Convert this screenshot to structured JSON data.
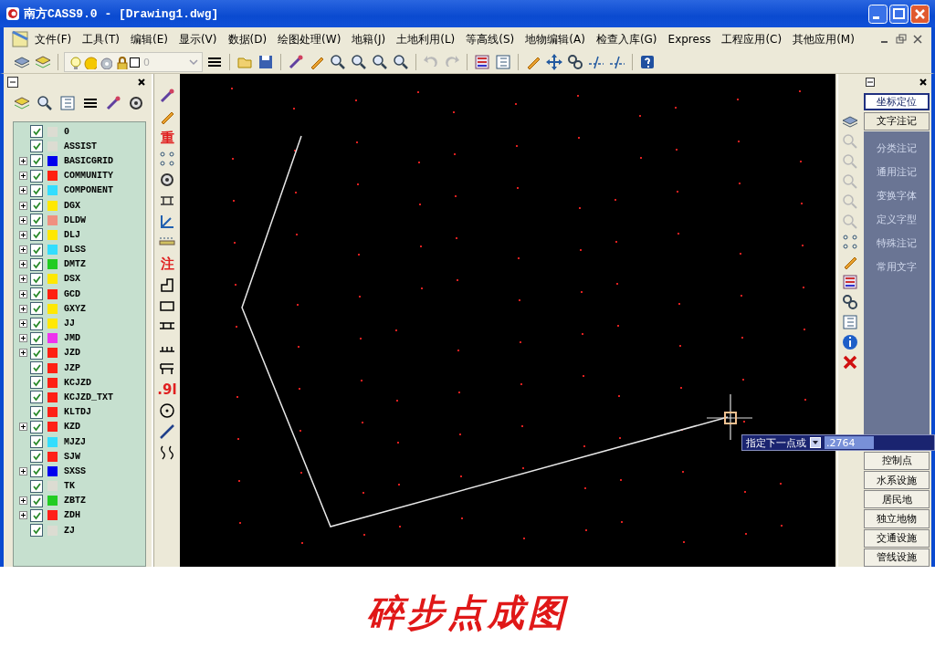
{
  "window": {
    "title": "南方CASS9.0 - [Drawing1.dwg]"
  },
  "menu": [
    "文件(F)",
    "工具(T)",
    "编辑(E)",
    "显示(V)",
    "数据(D)",
    "绘图处理(W)",
    "地籍(J)",
    "土地利用(L)",
    "等高线(S)",
    "地物编辑(A)",
    "检查入库(G)",
    "Express",
    "工程应用(C)",
    "其他应用(M)"
  ],
  "toolbar": {
    "layer_combo": {
      "value": "0"
    }
  },
  "layer_panel": {
    "layers": [
      {
        "name": "0",
        "kind": "leaf",
        "checked": true
      },
      {
        "name": "ASSIST",
        "kind": "leaf",
        "checked": true
      },
      {
        "name": "BASICGRID",
        "kind": "group",
        "checked": true,
        "color": "#0000ee"
      },
      {
        "name": "COMMUNITY",
        "kind": "group",
        "checked": true,
        "color": "#ff2010"
      },
      {
        "name": "COMPONENT",
        "kind": "group",
        "checked": true,
        "color": "#33ddff"
      },
      {
        "name": "DGX",
        "kind": "group",
        "checked": true,
        "color": "#ffe800"
      },
      {
        "name": "DLDW",
        "kind": "group",
        "checked": true,
        "color": "#f09080"
      },
      {
        "name": "DLJ",
        "kind": "group",
        "checked": true,
        "color": "#ffe801"
      },
      {
        "name": "DLSS",
        "kind": "group",
        "checked": true,
        "color": "#33ddfe"
      },
      {
        "name": "DMTZ",
        "kind": "group",
        "checked": true,
        "color": "#22cc22"
      },
      {
        "name": "DSX",
        "kind": "group",
        "checked": true,
        "color": "#ffe802"
      },
      {
        "name": "GCD",
        "kind": "group",
        "checked": true,
        "color": "#ff2011"
      },
      {
        "name": "GXYZ",
        "kind": "group",
        "checked": true,
        "color": "#ffe803"
      },
      {
        "name": "JJ",
        "kind": "group",
        "checked": true,
        "color": "#ffe804"
      },
      {
        "name": "JMD",
        "kind": "group",
        "checked": true,
        "color": "#ee33ee"
      },
      {
        "name": "JZD",
        "kind": "group",
        "checked": true,
        "color": "#ff2012"
      },
      {
        "name": "JZP",
        "kind": "leaf",
        "checked": true,
        "color": "#ff2013"
      },
      {
        "name": "KCJZD",
        "kind": "leaf",
        "checked": true,
        "color": "#ff2014"
      },
      {
        "name": "KCJZD_TXT",
        "kind": "leaf",
        "checked": true,
        "color": "#ff2015"
      },
      {
        "name": "KLTDJ",
        "kind": "leaf",
        "checked": true,
        "color": "#ff2016"
      },
      {
        "name": "KZD",
        "kind": "group",
        "checked": true,
        "color": "#ff2017"
      },
      {
        "name": "MJZJ",
        "kind": "leaf",
        "checked": true,
        "color": "#33ddfd"
      },
      {
        "name": "SJW",
        "kind": "leaf",
        "checked": true,
        "color": "#ff2018"
      },
      {
        "name": "SXSS",
        "kind": "group",
        "checked": true,
        "color": "#0000ef"
      },
      {
        "name": "TK",
        "kind": "leaf",
        "checked": true
      },
      {
        "name": "ZBTZ",
        "kind": "group",
        "checked": true,
        "color": "#22cc23"
      },
      {
        "name": "ZDH",
        "kind": "group",
        "checked": true,
        "color": "#ff2019"
      },
      {
        "name": "ZJ",
        "kind": "leaf",
        "checked": true
      }
    ]
  },
  "left_toolbar": [
    {
      "kind": "icon"
    },
    {
      "kind": "icon"
    },
    {
      "kind": "glyph",
      "label": "重"
    },
    {
      "kind": "icon"
    },
    {
      "kind": "icon"
    },
    {
      "kind": "icon"
    },
    {
      "kind": "icon"
    },
    {
      "kind": "icon"
    },
    {
      "kind": "glyph",
      "label": "注"
    },
    {
      "kind": "icon"
    },
    {
      "kind": "icon"
    },
    {
      "kind": "icon"
    },
    {
      "kind": "icon"
    },
    {
      "kind": "icon"
    },
    {
      "kind": "glyph",
      "label": ".9l"
    },
    {
      "kind": "icon"
    },
    {
      "kind": "icon"
    },
    {
      "kind": "icon"
    }
  ],
  "command_prompt": {
    "label": "指定下一点或",
    "value": ".2764"
  },
  "right_panel": {
    "tabs": [
      {
        "label": "坐标定位",
        "selected": true
      },
      {
        "label": "文字注记",
        "selected": false
      }
    ],
    "items": [
      "分类注记",
      "通用注记",
      "变换字体",
      "定义字型",
      "特殊注记",
      "常用文字"
    ],
    "categories": [
      "控制点",
      "水系设施",
      "居民地",
      "独立地物",
      "交通设施",
      "管线设施"
    ]
  },
  "caption": "碎步点成图"
}
